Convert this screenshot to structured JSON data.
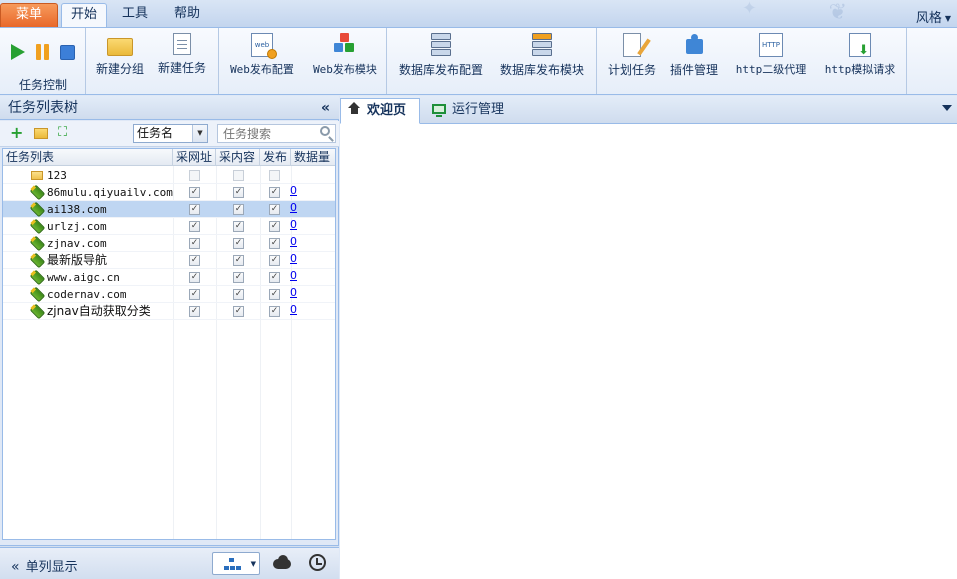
{
  "menubar": {
    "menu_label": "菜单",
    "tabs": [
      "开始",
      "工具",
      "帮助"
    ],
    "style_label": "风格"
  },
  "ribbon": {
    "task_control_label": "任务控制",
    "buttons": [
      "新建分组",
      "新建任务",
      "Web发布配置",
      "Web发布模块",
      "数据库发布配置",
      "数据库发布模块",
      "计划任务",
      "插件管理",
      "http二级代理",
      "http模拟请求"
    ],
    "icon_text": {
      "web": "web",
      "http": "HTTP"
    }
  },
  "left_panel": {
    "title": "任务列表树",
    "filter_value": "任务名",
    "search_placeholder": "任务搜索",
    "columns": [
      "任务列表",
      "采网址",
      "采内容",
      "发布",
      "数据量"
    ],
    "rows": [
      {
        "name": "123",
        "type": "folder",
        "collect_url": false,
        "collect_content": false,
        "publish": false,
        "count": "",
        "selected": false
      },
      {
        "name": "86mulu.qiyuailv.com",
        "type": "task",
        "collect_url": true,
        "collect_content": true,
        "publish": true,
        "count": "0",
        "selected": false
      },
      {
        "name": "ai138.com",
        "type": "task",
        "collect_url": true,
        "collect_content": true,
        "publish": true,
        "count": "0",
        "selected": true
      },
      {
        "name": "urlzj.com",
        "type": "task",
        "collect_url": true,
        "collect_content": true,
        "publish": true,
        "count": "0",
        "selected": false
      },
      {
        "name": "zjnav.com",
        "type": "task",
        "collect_url": true,
        "collect_content": true,
        "publish": true,
        "count": "0",
        "selected": false
      },
      {
        "name": "最新版导航",
        "type": "task",
        "collect_url": true,
        "collect_content": true,
        "publish": true,
        "count": "0",
        "selected": false
      },
      {
        "name": "www.aigc.cn",
        "type": "task",
        "collect_url": true,
        "collect_content": true,
        "publish": true,
        "count": "0",
        "selected": false
      },
      {
        "name": "codernav.com",
        "type": "task",
        "collect_url": true,
        "collect_content": true,
        "publish": true,
        "count": "0",
        "selected": false
      },
      {
        "name": "zjnav自动获取分类",
        "type": "task",
        "collect_url": true,
        "collect_content": true,
        "publish": true,
        "count": "0",
        "selected": false
      }
    ],
    "footer_label": "单列显示"
  },
  "right_panel": {
    "tabs": [
      "欢迎页",
      "运行管理"
    ],
    "active_tab": 0
  },
  "colors": {
    "menu_button": "#e8682a",
    "selection": "#bfd6f2",
    "accent": "#99bbe8",
    "play": "#27a032",
    "pause": "#f0a020",
    "stop": "#3c7fd8"
  }
}
